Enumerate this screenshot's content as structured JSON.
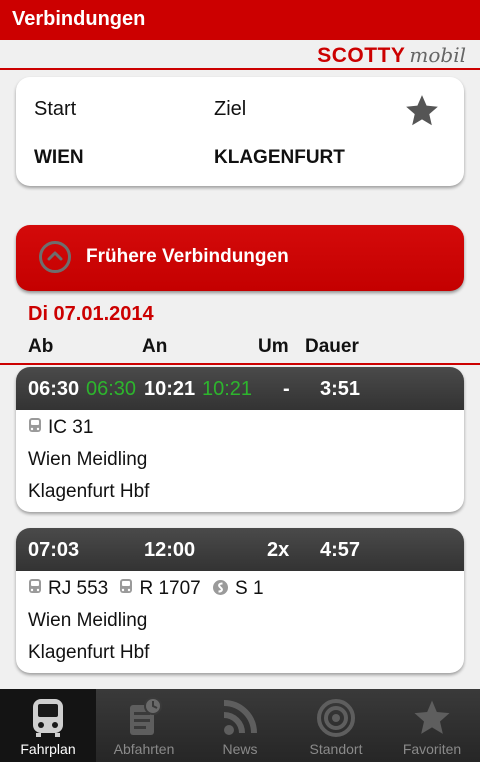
{
  "header": {
    "title": "Verbindungen"
  },
  "brand": {
    "part1": "SCOTTY",
    "part2": "mobil"
  },
  "search": {
    "start_label": "Start",
    "ziel_label": "Ziel",
    "start_value": "WIEN",
    "ziel_value": "KLAGENFURT",
    "favorite_icon": "star-icon"
  },
  "earlier_button": {
    "label": "Frühere Verbindungen",
    "icon": "chevron-up-circle-icon"
  },
  "results": {
    "date": "Di 07.01.2014",
    "columns": {
      "ab": "Ab",
      "an": "An",
      "um": "Um",
      "dauer": "Dauer"
    },
    "connections": [
      {
        "dep": "06:30",
        "dep_rt": "06:30",
        "arr": "10:21",
        "arr_rt": "10:21",
        "changes": "-",
        "duration": "3:51",
        "trains": [
          {
            "icon": "train-icon",
            "name": "IC 31"
          }
        ],
        "from": "Wien Meidling",
        "to": "Klagenfurt Hbf"
      },
      {
        "dep": "07:03",
        "dep_rt": "",
        "arr": "12:00",
        "arr_rt": "",
        "changes": "2x",
        "duration": "4:57",
        "trains": [
          {
            "icon": "train-icon",
            "name": "RJ 553"
          },
          {
            "icon": "train-icon",
            "name": "R 1707"
          },
          {
            "icon": "s-bahn-icon",
            "name": "S 1"
          }
        ],
        "from": "Wien Meidling",
        "to": "Klagenfurt Hbf"
      }
    ]
  },
  "nav": [
    {
      "label": "Fahrplan",
      "icon": "train-icon",
      "active": true
    },
    {
      "label": "Abfahrten",
      "icon": "departures-icon",
      "active": false
    },
    {
      "label": "News",
      "icon": "rss-icon",
      "active": false
    },
    {
      "label": "Standort",
      "icon": "location-target-icon",
      "active": false
    },
    {
      "label": "Favoriten",
      "icon": "star-icon",
      "active": false
    }
  ],
  "colors": {
    "accent": "#cc0000",
    "realtime": "#2db52d",
    "header_dark": "#3a3a3a"
  }
}
